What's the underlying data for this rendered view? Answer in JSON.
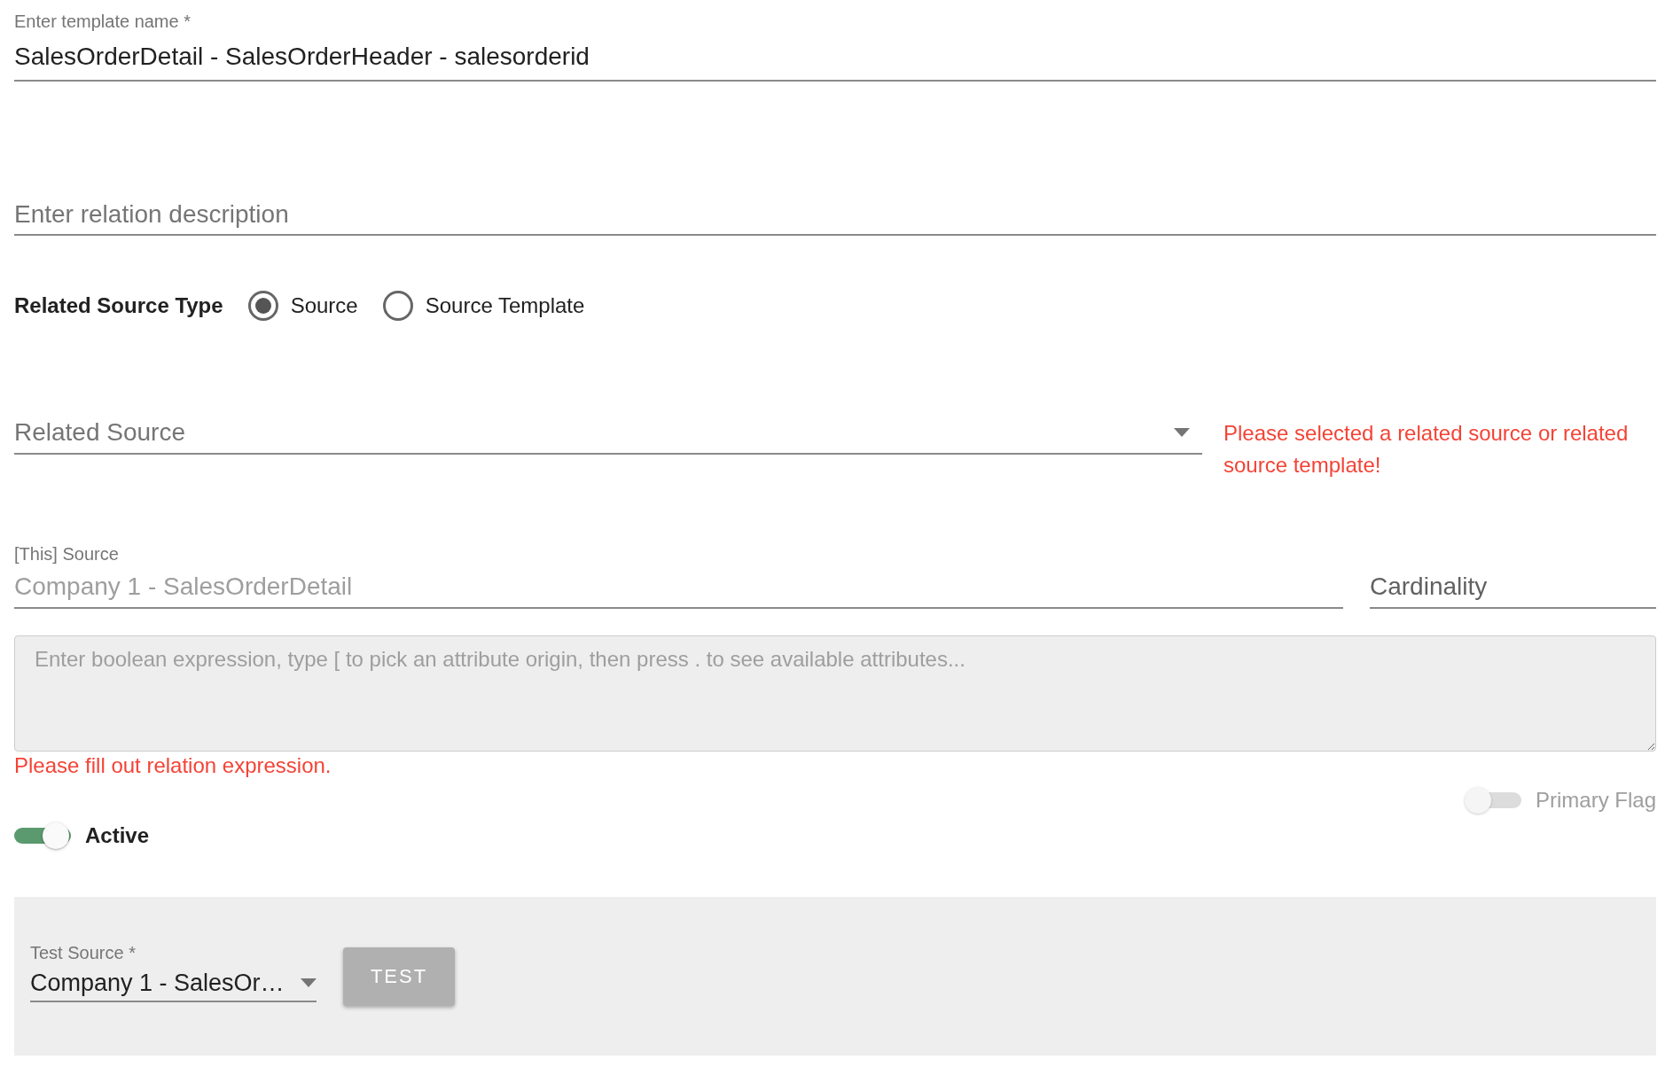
{
  "template_name": {
    "label": "Enter template name *",
    "value": "SalesOrderDetail - SalesOrderHeader - salesorderid"
  },
  "description": {
    "placeholder": "Enter relation description"
  },
  "related_source_type": {
    "label": "Related Source Type",
    "options": [
      {
        "label": "Source",
        "selected": true
      },
      {
        "label": "Source Template",
        "selected": false
      }
    ]
  },
  "related_source": {
    "placeholder": "Related Source",
    "error": "Please selected a related source or related source template!"
  },
  "this_source": {
    "label": "[This] Source",
    "value": "Company 1 - SalesOrderDetail",
    "disabled": true
  },
  "cardinality": {
    "placeholder": "Cardinality"
  },
  "expression": {
    "placeholder": "Enter boolean expression, type [ to pick an attribute origin, then press . to see available attributes...",
    "error": "Please fill out relation expression."
  },
  "primary_flag": {
    "label": "Primary Flag",
    "on": false,
    "disabled": true
  },
  "active": {
    "label": "Active",
    "on": true
  },
  "test_panel": {
    "test_source": {
      "label": "Test Source *",
      "value": "Company 1 - SalesOr…"
    },
    "test_button": {
      "label": "TEST",
      "disabled": true
    }
  }
}
